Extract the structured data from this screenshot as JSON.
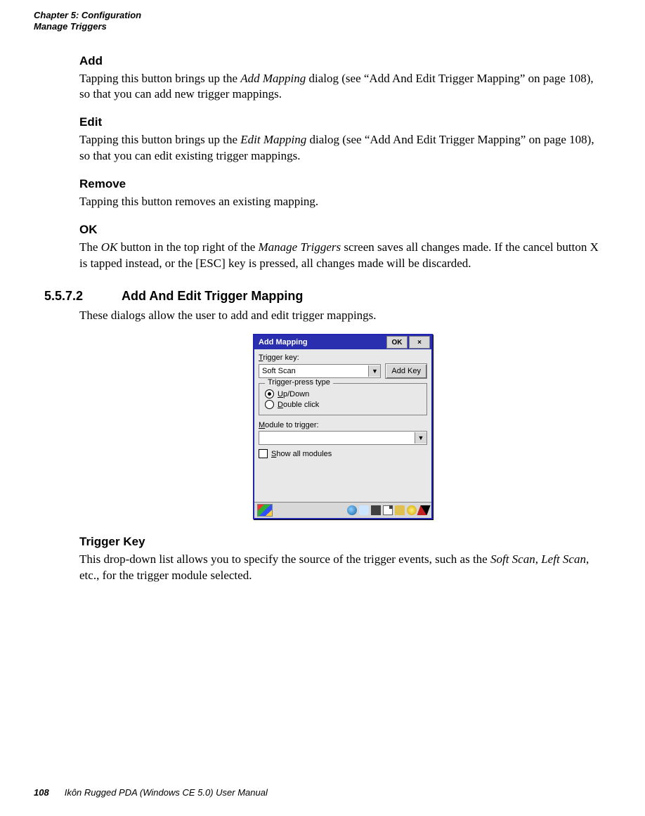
{
  "running_head": {
    "line1": "Chapter 5:  Configuration",
    "line2": "Manage Triggers"
  },
  "sections": {
    "add": {
      "title": "Add",
      "text_pre": "Tapping this button brings up the ",
      "text_em": "Add Mapping",
      "text_post": " dialog (see “Add And Edit Trigger Mapping” on page 108), so that you can add new trigger mappings."
    },
    "edit": {
      "title": "Edit",
      "text_pre": "Tapping this button brings up the ",
      "text_em": "Edit Mapping",
      "text_post": " dialog (see “Add And Edit Trigger Mapping” on page 108), so that you can edit existing trigger mappings."
    },
    "remove": {
      "title": "Remove",
      "text": "Tapping this button removes an existing mapping."
    },
    "ok": {
      "title": "OK",
      "text_pre": "The ",
      "text_em1": "OK",
      "text_mid": " button in the top right of the ",
      "text_em2": "Manage Triggers",
      "text_post": " screen saves all changes made. If the cancel button X is tapped instead, or the [ESC] key is pressed, all changes made will be discarded."
    },
    "num_section": {
      "number": "5.5.7.2",
      "title": "Add And Edit Trigger Mapping",
      "intro": "These dialogs allow the user to add and edit trigger mappings."
    },
    "trigger_key": {
      "title": "Trigger Key",
      "text_pre": "This drop-down list allows you to specify the source of the trigger events, such as the ",
      "text_em1": "Soft Scan",
      "text_mid": ", ",
      "text_em2": "Left Scan",
      "text_post": ", etc., for the trigger module selected."
    }
  },
  "dialog": {
    "title": "Add Mapping",
    "ok_label": "OK",
    "close_label": "×",
    "trigger_key_label": "Trigger key:",
    "trigger_key_value": "Soft Scan",
    "add_key_button": "Add Key",
    "group_legend": "Trigger-press type",
    "radio_updown": "Up/Down",
    "radio_double": "Double click",
    "module_label": "Module to trigger:",
    "module_value": "",
    "show_all_label": "Show all modules"
  },
  "footer": {
    "page_number": "108",
    "manual_title": "Ikôn Rugged PDA (Windows CE 5.0) User Manual"
  }
}
